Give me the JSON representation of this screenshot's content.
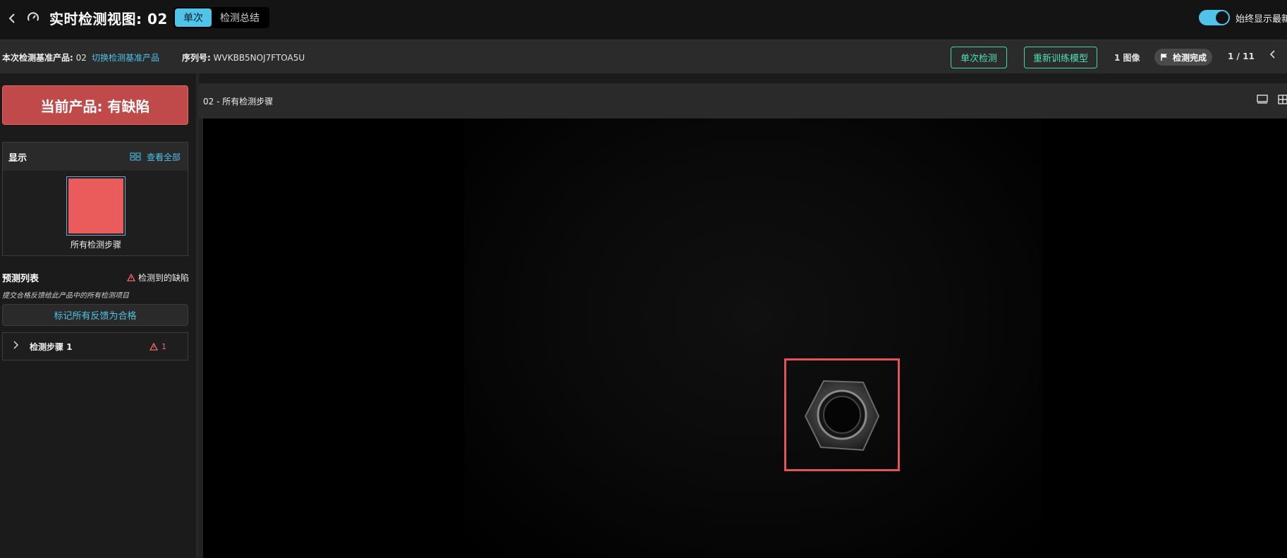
{
  "header": {
    "title": "实时检测视图: 02",
    "tabs": [
      {
        "label": "单次",
        "active": true
      },
      {
        "label": "检测总结",
        "active": false
      }
    ],
    "toggle_label": "始终显示最新",
    "toggle_on": true
  },
  "infobar": {
    "baseline_label": "本次检测基准产品:",
    "baseline_value": "02",
    "switch_link": "切换检测基准产品",
    "serial_label": "序列号:",
    "serial_value": "WVKBB5NOJ7FTOA5U",
    "single_inspect_button": "单次检测",
    "retrain_button": "重新训练模型",
    "image_count": "1 图像",
    "status_pill": "检测完成",
    "pager": "1 / 11"
  },
  "sidebar": {
    "product_status": "当前产品: 有缺陷",
    "display_title": "显示",
    "view_all": "查看全部",
    "thumbnail_label": "所有检测步骤",
    "prediction_title": "预测列表",
    "defects_found": "检测到的缺陷",
    "hint": "提交合格反馈给此产品中的所有检测项目",
    "mark_all_button": "标记所有反馈为合格",
    "steps": [
      {
        "label": "检测步骤 1",
        "defect_count": "1"
      }
    ]
  },
  "viewer": {
    "title": "02 - 所有检测步骤"
  },
  "colors": {
    "accent": "#4fc3e8",
    "action_green": "#3fd6a8",
    "defect_red": "#e05656"
  }
}
